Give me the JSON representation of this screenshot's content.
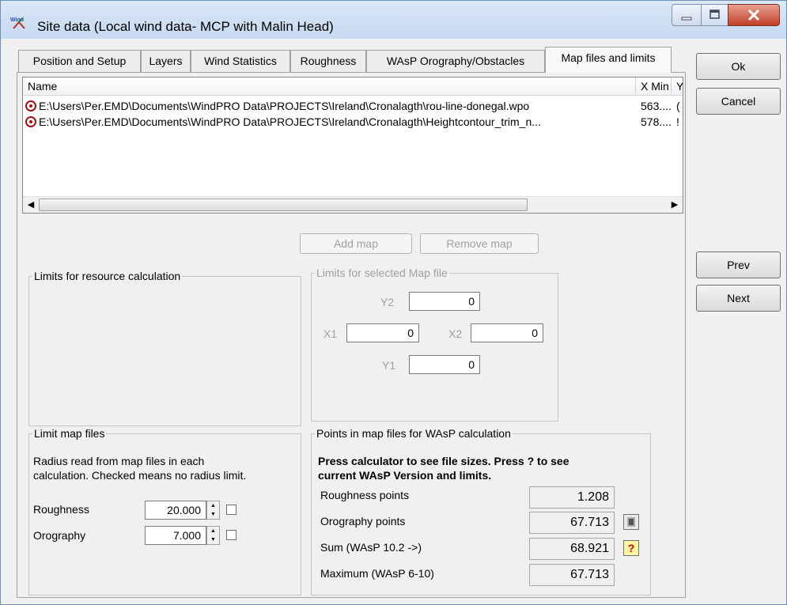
{
  "window": {
    "title": "Site data  (Local wind data- MCP with Malin Head)"
  },
  "tabs": [
    {
      "label": "Position and Setup"
    },
    {
      "label": "Layers"
    },
    {
      "label": "Wind Statistics"
    },
    {
      "label": "Roughness"
    },
    {
      "label": "WAsP Orography/Obstacles"
    },
    {
      "label": "Map files and limits"
    }
  ],
  "file_list": {
    "columns": [
      "Name",
      "X Min",
      "Y"
    ],
    "rows": [
      {
        "name": "E:\\Users\\Per.EMD\\Documents\\WindPRO Data\\PROJECTS\\Ireland\\Cronalagth\\rou-line-donegal.wpo",
        "xmin": "563....",
        "y": "("
      },
      {
        "name": "E:\\Users\\Per.EMD\\Documents\\WindPRO Data\\PROJECTS\\Ireland\\Cronalagth\\Heightcontour_trim_n...",
        "xmin": "578....",
        "y": "!"
      }
    ]
  },
  "buttons": {
    "add_map": "Add map",
    "remove_map": "Remove map",
    "ok": "Ok",
    "cancel": "Cancel",
    "prev": "Prev",
    "next": "Next"
  },
  "limits_resource": {
    "title": "Limits for resource calculation"
  },
  "limits_selected": {
    "title": "Limits for selected Map file",
    "y2_label": "Y2",
    "y2": "0",
    "x1_label": "X1",
    "x1": "0",
    "x2_label": "X2",
    "x2": "0",
    "y1_label": "Y1",
    "y1": "0"
  },
  "limit_map_files": {
    "title": "Limit map files",
    "description_line1": "Radius read from map files in each",
    "description_line2": "calculation. Checked means no radius limit.",
    "roughness_label": "Roughness",
    "roughness_value": "20.000",
    "orography_label": "Orography",
    "orography_value": "7.000"
  },
  "points": {
    "title": "Points in map files for WAsP calculation",
    "note_line1": "Press calculator to see file sizes. Press ? to see",
    "note_line2": "current WAsP Version and limits.",
    "roughness_label": "Roughness points",
    "roughness_value": "1.208",
    "orography_label": "Orography points",
    "orography_value": "67.713",
    "sum_label": "Sum (WAsP 10.2 ->)",
    "sum_value": "68.921",
    "max_label": "Maximum (WAsP 6-10)",
    "max_value": "67.713",
    "help_glyph": "?"
  }
}
